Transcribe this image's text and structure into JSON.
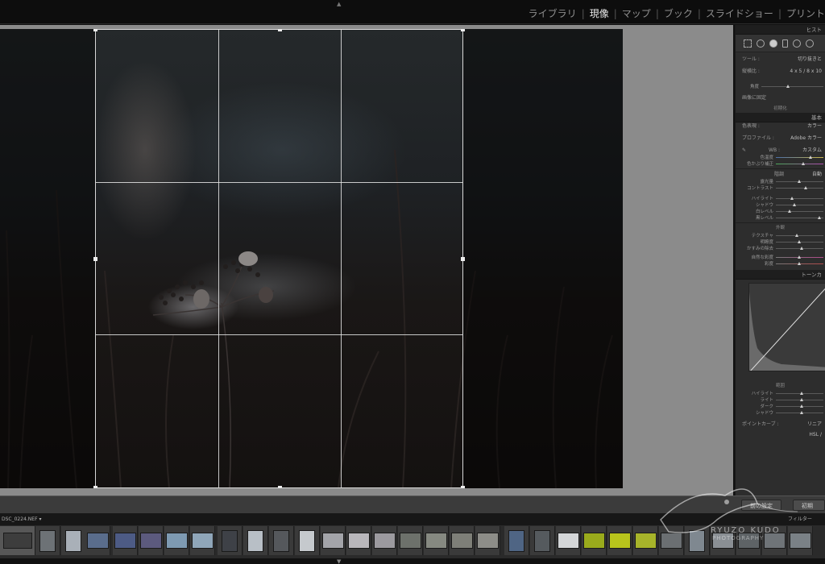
{
  "topbar": {
    "modules": [
      {
        "label": "ライブラリ",
        "active": false
      },
      {
        "label": "現像",
        "active": true
      },
      {
        "label": "マップ",
        "active": false
      },
      {
        "label": "ブック",
        "active": false
      },
      {
        "label": "スライドショー",
        "active": false
      },
      {
        "label": "プリント",
        "active": false
      }
    ]
  },
  "right_panel": {
    "histogram_header": "ヒスト",
    "crop": {
      "tool_label": "ツール :",
      "tool_value": "切り抜きと",
      "aspect_label": "縦横比 :",
      "aspect_value": "4 x 5 / 8 x 10",
      "angle_label": "角度",
      "constrain_label": "画像に固定",
      "reset_label": "初期化"
    },
    "basic": {
      "header": "基本",
      "treatment_label": "色表現 :",
      "treatment_value": "カラー",
      "profile_label": "プロファイル :",
      "profile_value": "Adobe カラー",
      "wb_label": "WB :",
      "wb_value": "カスタム",
      "temp_label": "色温度",
      "tint_label": "色かぶり補正",
      "tone_header": "階調",
      "tone_auto": "自動",
      "exposure_label": "露光量",
      "contrast_label": "コントラスト",
      "highlights_label": "ハイライト",
      "shadows_label": "シャドウ",
      "whites_label": "白レベル",
      "blacks_label": "黒レベル",
      "presence_header": "外観",
      "texture_label": "テクスチャ",
      "clarity_label": "明瞭度",
      "dehaze_label": "かすみの除去",
      "vibrance_label": "自然な彩度",
      "saturation_label": "彩度"
    },
    "tone_curve": {
      "header": "トーンカ",
      "region_header": "範囲",
      "highlights_label": "ハイライト",
      "lights_label": "ライト",
      "darks_label": "ダーク",
      "shadows_label": "シャドウ",
      "point_curve_label": "ポイントカーブ :",
      "point_curve_value": "リニア"
    },
    "hsl_label": "HSL /"
  },
  "bottom_toolbar": {
    "previous_label": "前の設定",
    "reset_label": "初期化"
  },
  "filmstrip": {
    "filename": "DSC_0224.NEF",
    "filter_label": "フィルター"
  },
  "watermark": {
    "line1": "RYUZO KUDO",
    "line2": "PHOTOGRAPHY"
  },
  "colors": {
    "active_module": "#e8e8e8",
    "inactive_module": "#8e8e8e",
    "panel_bg": "#2d2d2d",
    "canvas_bg": "#8b8b8b"
  }
}
